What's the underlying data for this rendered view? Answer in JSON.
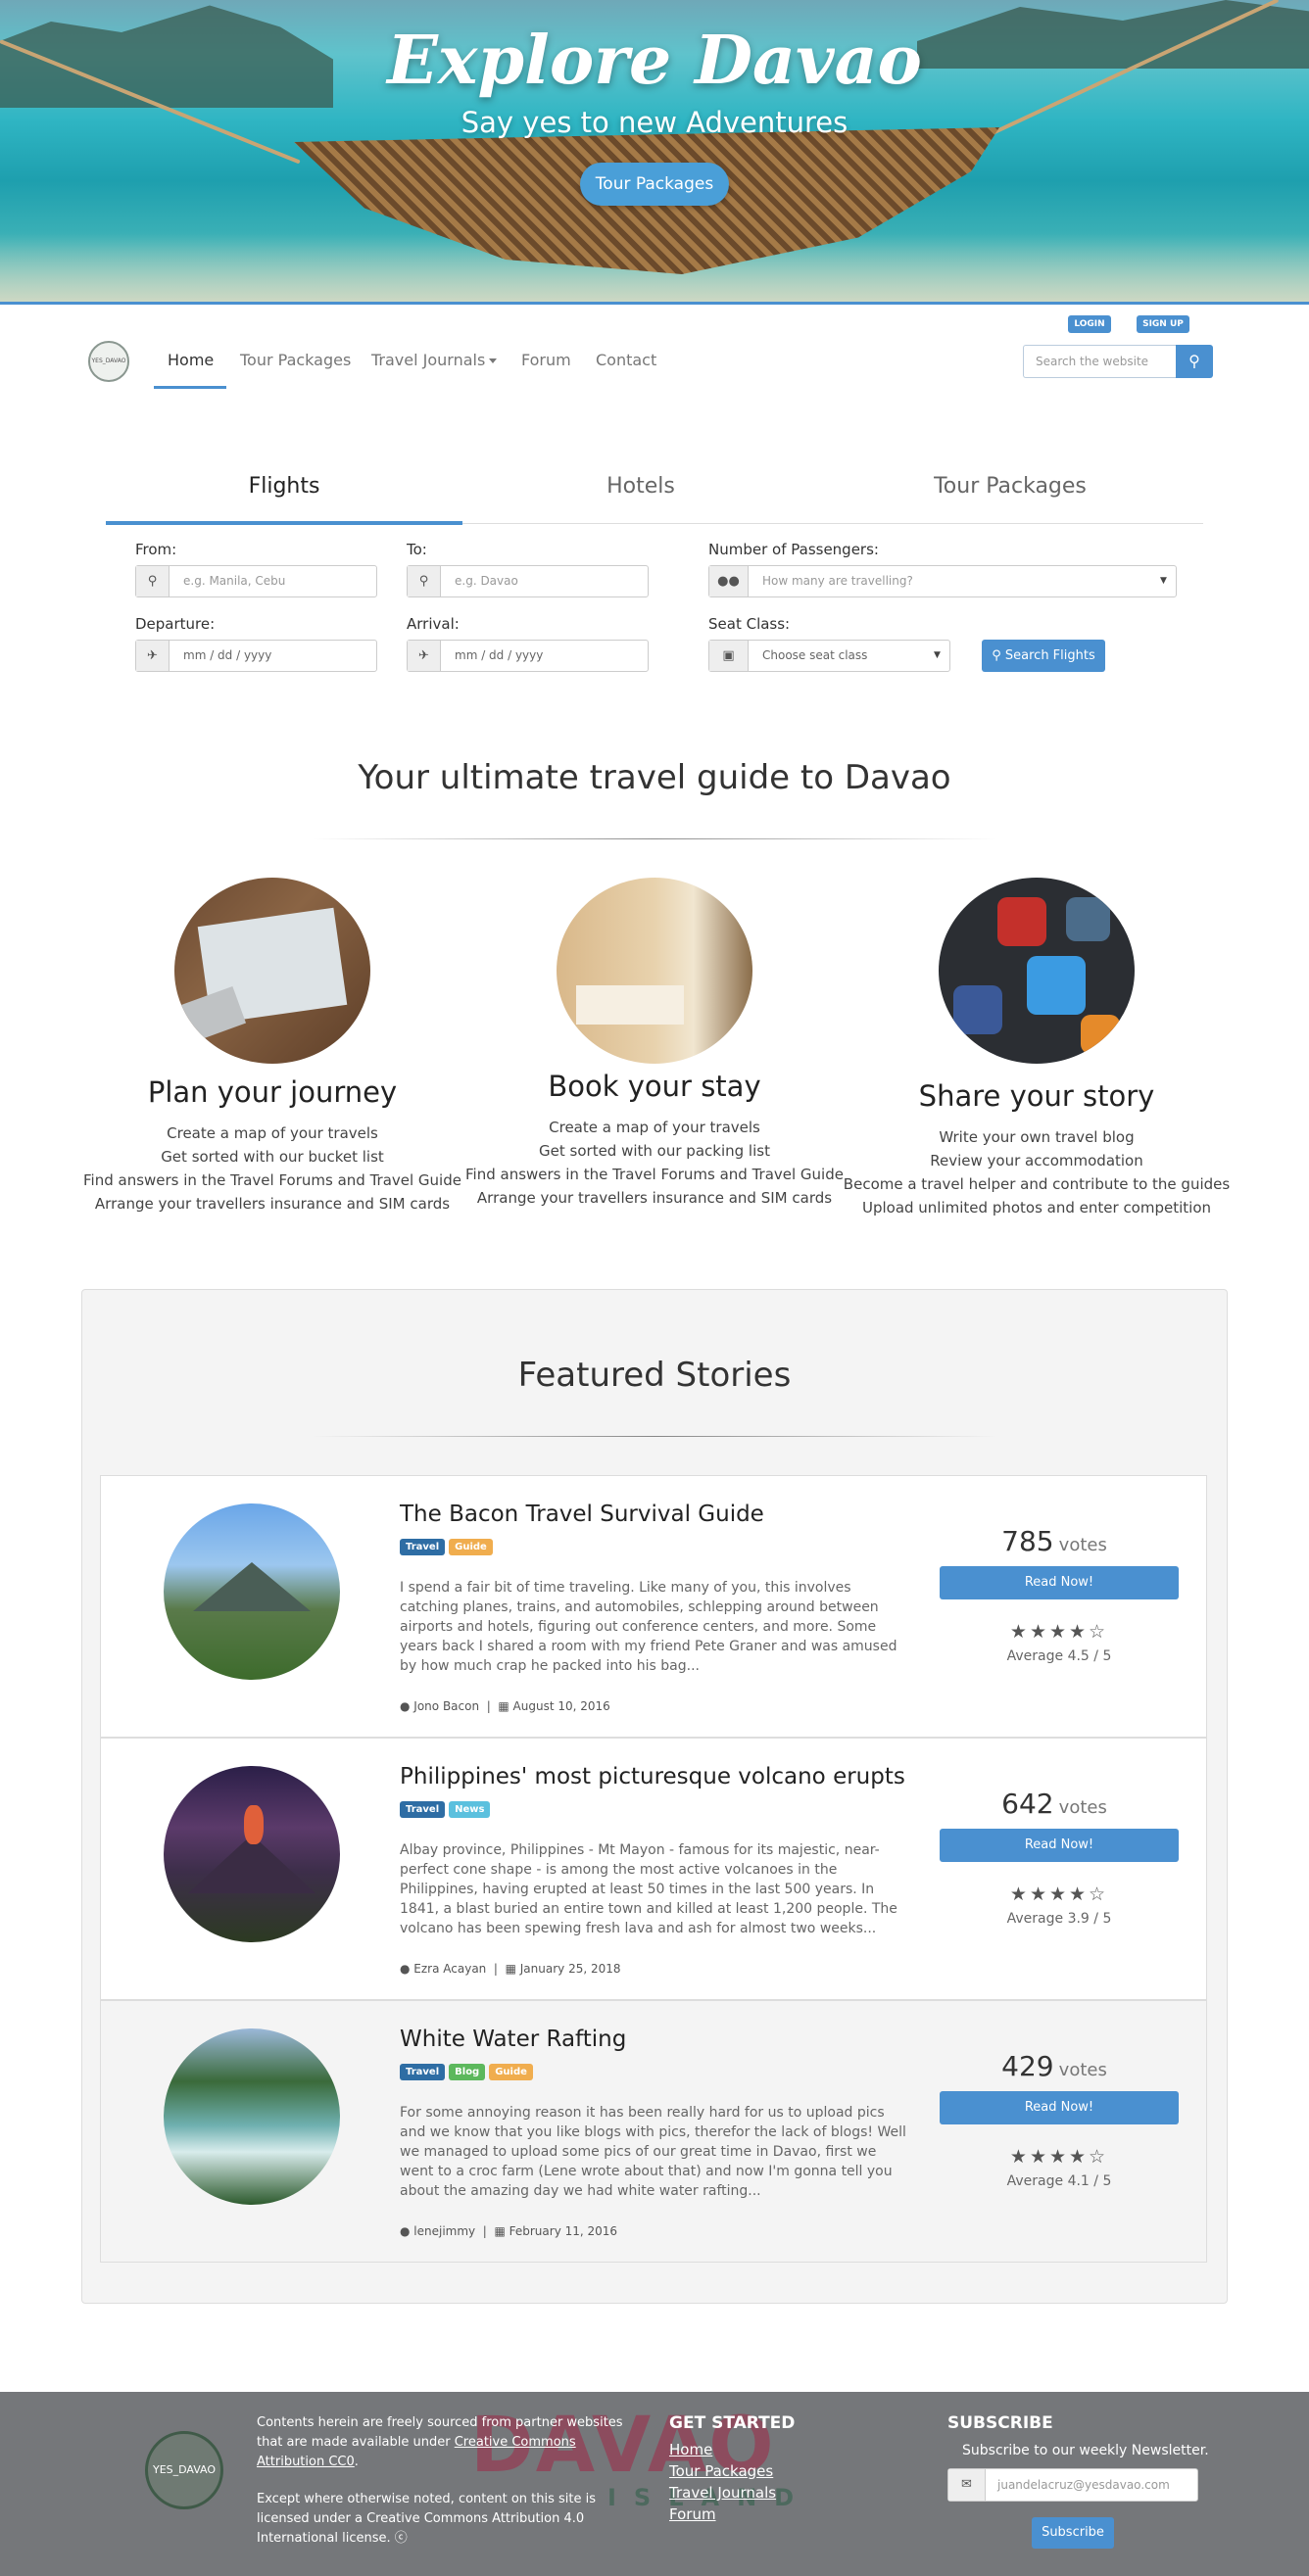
{
  "hero": {
    "title": "Explore Davao",
    "subtitle": "Say yes to new Adventures",
    "button": "Tour Packages"
  },
  "auth": {
    "login": "LOGIN",
    "signup": "SIGN UP"
  },
  "logo": {
    "text": "YES_DAVAO"
  },
  "nav": {
    "items": [
      {
        "label": "Home"
      },
      {
        "label": "Tour Packages"
      },
      {
        "label": "Travel Journals"
      },
      {
        "label": "Forum"
      },
      {
        "label": "Contact"
      }
    ],
    "search_placeholder": "Search the website"
  },
  "booking": {
    "tabs": [
      "Flights",
      "Hotels",
      "Tour Packages"
    ],
    "from_label": "From:",
    "from_placeholder": "e.g. Manila, Cebu",
    "to_label": "To:",
    "to_placeholder": "e.g. Davao",
    "passengers_label": "Number of Passengers:",
    "passengers_placeholder": "How many are travelling?",
    "departure_label": "Departure:",
    "departure_placeholder": "mm / dd / yyyy",
    "arrival_label": "Arrival:",
    "arrival_placeholder": "mm / dd / yyyy",
    "seat_label": "Seat Class:",
    "seat_placeholder": "Choose seat class",
    "search_button": "Search Flights"
  },
  "guide": {
    "title": "Your ultimate travel guide to Davao",
    "features": [
      {
        "title": "Plan your journey",
        "lines": [
          "Create a map of your travels",
          "Get sorted with our bucket list",
          "Find answers in the Travel Forums and Travel Guide",
          "Arrange your travellers insurance and SIM cards"
        ]
      },
      {
        "title": "Book your stay",
        "lines": [
          "Create a map of your travels",
          "Get sorted with our packing list",
          "Find answers in the Travel Forums and Travel Guide",
          "Arrange your travellers insurance and SIM cards"
        ]
      },
      {
        "title": "Share your story",
        "lines": [
          "Write your own travel blog",
          "Review your accommodation",
          "Become a travel helper and contribute to the guides",
          "Upload unlimited photos and enter competition"
        ]
      }
    ]
  },
  "featured": {
    "title": "Featured Stories",
    "stories": [
      {
        "title": "The Bacon Travel Survival Guide",
        "tags": [
          "Travel",
          "Guide"
        ],
        "text": "I spend a fair bit of time traveling. Like many of you, this involves catching planes, trains, and automobiles, schlepping around between airports and hotels, figuring out conference centers, and more. Some years back I shared a room with my friend Pete Graner and was amused by how much crap he packed into his bag...",
        "author": "Jono Bacon",
        "date": "August 10, 2016",
        "votes": "785",
        "votes_label": "votes",
        "button": "Read Now!",
        "stars": "★★★★☆",
        "rating": 4.5,
        "average": "Average 4.5 / 5"
      },
      {
        "title": "Philippines' most picturesque volcano erupts",
        "tags": [
          "Travel",
          "News"
        ],
        "text": "Albay province, Philippines - Mt Mayon - famous for its majestic, near-perfect cone shape - is among the most active volcanoes in the Philippines, having erupted at least 50 times in the last 500 years. In 1841, a blast buried an entire town and killed at least 1,200 people. The volcano has been spewing fresh lava and ash for almost two weeks...",
        "author": "Ezra Acayan",
        "date": "January 25, 2018",
        "votes": "642",
        "votes_label": "votes",
        "button": "Read Now!",
        "stars": "★★★★☆",
        "rating": 3.9,
        "average": "Average 3.9 / 5"
      },
      {
        "title": "White Water Rafting",
        "tags": [
          "Travel",
          "Blog",
          "Guide"
        ],
        "text": "For some annoying reason it has been really hard for us to upload pics and we know that you like blogs with pics, therefor the lack of blogs! Well we managed to upload some pics of our great time in Davao, first we went to a croc farm (Lene wrote about that) and now I'm gonna tell you about the amazing day we had white water rafting...",
        "author": "lenejimmy",
        "date": "February 11, 2016",
        "votes": "429",
        "votes_label": "votes",
        "button": "Read Now!",
        "stars": "★★★★☆",
        "rating": 4.1,
        "average": "Average 4.1 / 5"
      }
    ]
  },
  "footer": {
    "logo_text": "YES_DAVAO",
    "text_1a": "Contents herein are freely sourced from partner websites that are made available under ",
    "text_1_link": "Creative Commons Attribution CC0",
    "text_1b": ".",
    "text_2": "Except where otherwise noted, content on this site is licensed under a Creative Commons Attribution 4.0 International license. ⓒ",
    "watermark_main": "DAVAO",
    "watermark_sub": "ISLAND",
    "get_started_title": "GET STARTED",
    "links": [
      "Home",
      "Tour Packages",
      "Travel Journals",
      "Forum"
    ],
    "subscribe_title": "SUBSCRIBE",
    "subscribe_note": "Subscribe to our weekly Newsletter.",
    "email_placeholder": "juandelacruz@yesdavao.com",
    "subscribe_button": "Subscribe"
  },
  "colors": {
    "accent": "#4a90d0",
    "footer_bg": "#75777a",
    "tag_travel": "#2e6da4",
    "tag_guide": "#f0ad4e",
    "tag_news": "#5bc0de",
    "tag_blog": "#5cb85c"
  }
}
